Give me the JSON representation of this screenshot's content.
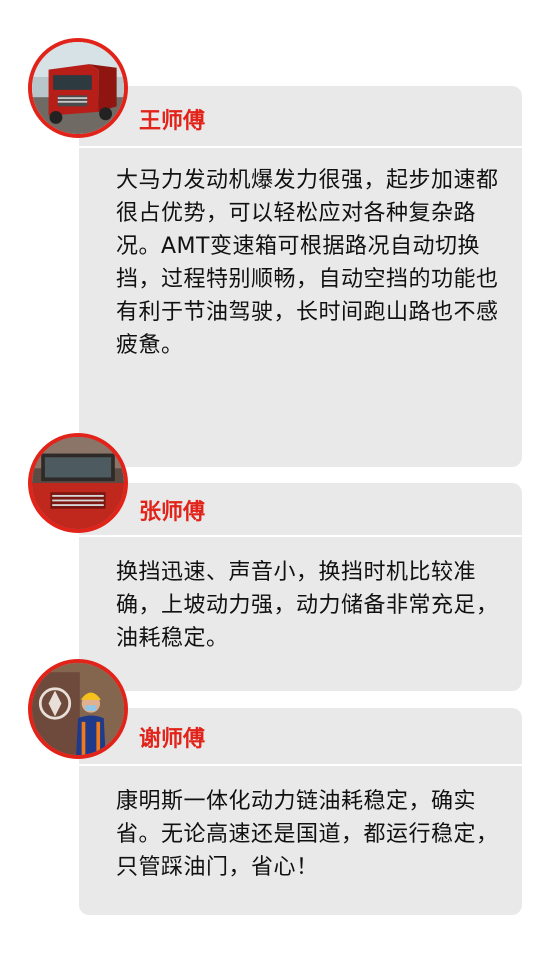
{
  "reviews": [
    {
      "name": "王师傅",
      "text": "大马力发动机爆发力很强，起步加速都很占优势，可以轻松应对各种复杂路况。AMT变速箱可根据路况自动切换挡，过程特别顺畅，自动空挡的功能也有利于节油驾驶，长时间跑山路也不感疲惫。",
      "avatar_icon": "red-truck-photo-icon"
    },
    {
      "name": "张师傅",
      "text": "换挡迅速、声音小，换挡时机比较准确，上坡动力强，动力储备非常充足，油耗稳定。",
      "avatar_icon": "truck-cab-photo-icon"
    },
    {
      "name": "谢师傅",
      "text": "康明斯一体化动力链油耗稳定，确实省。无论高速还是国道，都运行稳定，只管踩油门，省心！",
      "avatar_icon": "driver-with-truck-photo-icon"
    }
  ],
  "colors": {
    "accent": "#e2231a",
    "card_background": "#e9e9e9",
    "text": "#111111"
  }
}
